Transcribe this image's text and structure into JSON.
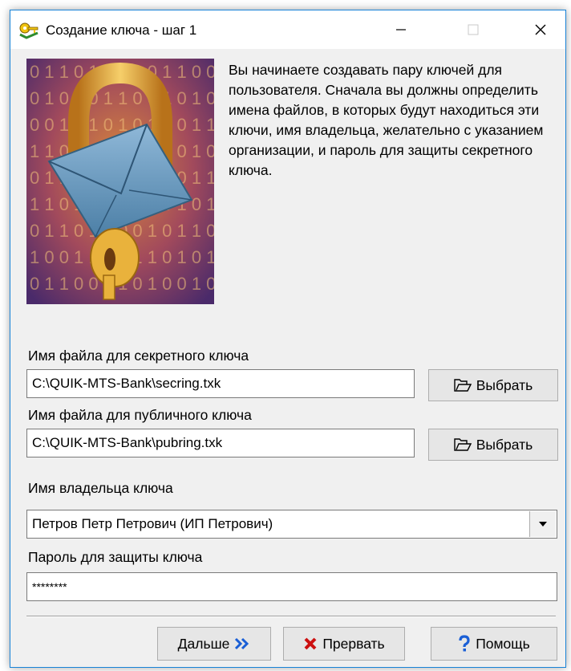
{
  "window": {
    "title": "Создание ключа - шаг 1",
    "app_icon": "key-wizard-icon",
    "controls": [
      "minimize-icon",
      "maximize-icon",
      "close-icon"
    ]
  },
  "picture": {
    "icon": "padlock-envelope-illustration",
    "digits": [
      "0 1 1 0 1 1 0 0 0 1 1 0 0",
      "0 1 0 1 0 1 1 0 0 1 0 1 0",
      "0 0 1 0 1 0 1 0 1 0 0 1 1",
      "1 1 0 1 0 0 1 1 0 1 0 1 0",
      "0 1 1 0 0 0 1 0 1 1 0 1 1",
      "1 1 0 1 0 1 0 1 1 0 1 0 1",
      "0 1 1 0 1 1 0 0 1 0 1 1 0",
      "1 0 0 1 1 0 0 1 1 0 1 0 1",
      "0 1 1 0 0 1 1 0 1 0 0 1 0"
    ]
  },
  "intro_text": "Вы начинаете создавать пару ключей для пользователя. Сначала вы должны определить имена файлов, в которых будут находиться эти ключи, имя владельца, желательно с указанием организации, и  пароль для защиты секретного ключа.",
  "secret_key": {
    "label": "Имя файла для секретного ключа",
    "value": "C:\\QUIK-MTS-Bank\\secring.txk",
    "browse_label": "Выбрать"
  },
  "public_key": {
    "label": "Имя файла для публичного ключа",
    "value": "C:\\QUIK-MTS-Bank\\pubring.txk",
    "browse_label": "Выбрать"
  },
  "owner": {
    "label": "Имя владельца ключа",
    "value": "Петров Петр Петрович (ИП Петрович)"
  },
  "password": {
    "label": "Пароль для защиты ключа",
    "value": "********"
  },
  "buttons": {
    "next": "Дальше",
    "abort": "Прервать",
    "help": "Помощь"
  },
  "colors": {
    "window_border": "#1883d7",
    "dialog_bg": "#f0f0f0",
    "next_arrow": "#1a5fd6",
    "abort_x": "#cc1010",
    "help_mark": "#1a5fd6"
  }
}
